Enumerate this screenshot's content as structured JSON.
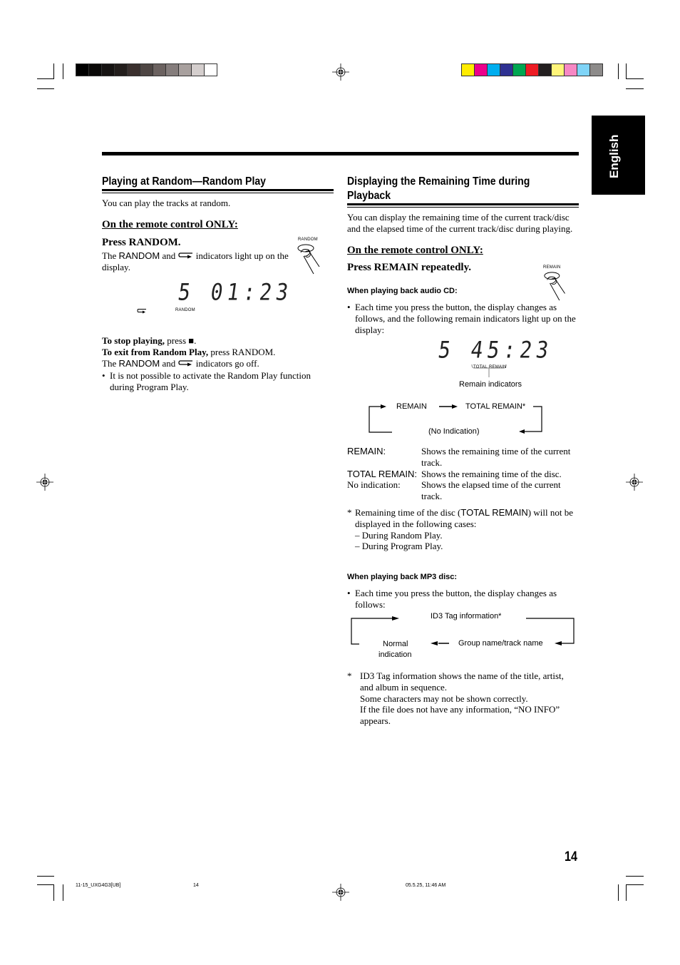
{
  "print_marks": {
    "grayscale_swatches": [
      "#000000",
      "#0a0908",
      "#161312",
      "#231e1c",
      "#3a302e",
      "#4e4644",
      "#6b6260",
      "#857d7c",
      "#a8a09e",
      "#d4cecd",
      "#ffffff"
    ],
    "color_swatches": [
      "#ffec00",
      "#ec008c",
      "#00aeef",
      "#2e3192",
      "#00a651",
      "#ed1c24",
      "#231f20",
      "#fff57a",
      "#f688c4",
      "#7fd4f7",
      "#8d8b8a"
    ]
  },
  "language_tab": "English",
  "left": {
    "title": "Playing at Random—Random Play",
    "intro": "You can play the tracks at random.",
    "remote_heading": "On the remote control ONLY:",
    "step": "Press RANDOM.",
    "step_desc_parts": [
      "The ",
      "RANDOM",
      " and ",
      " indicators light up on the display."
    ],
    "button_label": "RANDOM",
    "display": {
      "value": "5 01:23",
      "indicator_label": "RANDOM"
    },
    "stop_bold": "To stop playing,",
    "stop_rest": " press ■.",
    "exit_bold": "To exit from Random Play,",
    "exit_rest": " press RANDOM.",
    "off_parts": [
      "The ",
      "RANDOM",
      " and ",
      " indicators go off."
    ],
    "note": "It is not possible to activate the Random Play function during Program Play."
  },
  "right": {
    "title_line1": "Displaying the Remaining Time during",
    "title_line2": "Playback",
    "intro": "You can display the remaining time of the current track/disc and the elapsed time of the current track/disc during playing.",
    "remote_heading": "On the remote control ONLY:",
    "step": "Press REMAIN repeatedly.",
    "button_label": "REMAIN",
    "cd_heading": "When playing back audio CD:",
    "cd_bullet": "Each time you press the button, the display changes as follows, and the following remain indicators light up on the display:",
    "display": {
      "value": "5 45:23",
      "ind_total": "TOTAL",
      "ind_remain": "REMAIN",
      "caption": "Remain indicators"
    },
    "cycle": {
      "a": "REMAIN",
      "b": "TOTAL REMAIN*",
      "c": "(No Indication)"
    },
    "definitions": [
      {
        "term": "REMAIN:",
        "desc": "Shows the remaining time of the current track."
      },
      {
        "term": "TOTAL REMAIN:",
        "desc": "Shows the remaining time of the disc."
      },
      {
        "term": "No indication:",
        "desc": "Shows the elapsed time of the current track."
      }
    ],
    "footnote_parts": [
      "Remaining time of the disc (",
      "TOTAL REMAIN",
      ") will not be displayed in the following cases:"
    ],
    "footnote_cases": [
      "– During Random Play.",
      "– During Program Play."
    ],
    "mp3_heading": "When playing back MP3 disc:",
    "mp3_bullet": "Each time you press the button, the display changes as follows:",
    "mp3_cycle": {
      "a": "ID3 Tag information*",
      "b": "Group name/track name",
      "c1": "Normal",
      "c2": "indication"
    },
    "mp3_note": [
      "ID3 Tag information shows the name of the title, artist, and album in sequence.",
      "Some characters may not be shown correctly.",
      "If the file does not have any information, “NO INFO” appears."
    ]
  },
  "page_number": "14",
  "footer": {
    "file": "11-15_UXG4G3[UB]",
    "page": "14",
    "timestamp": "05.5.25, 11:46 AM"
  }
}
